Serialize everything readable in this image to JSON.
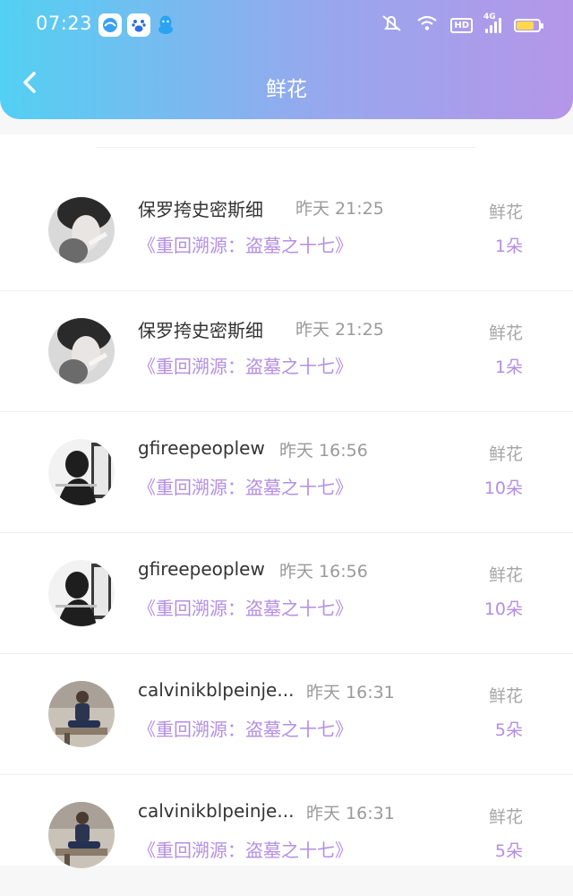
{
  "status_bar": {
    "time": "07:23",
    "network": "4G",
    "hd": "HD",
    "battery_level": 0.85,
    "icons": [
      "browser-app-icon",
      "baidu-app-icon",
      "qq-app-icon",
      "mute-icon",
      "wifi-icon",
      "hd-icon",
      "signal-icon",
      "battery-icon"
    ]
  },
  "nav": {
    "title": "鲜花",
    "back_icon": "chevron-left-icon"
  },
  "colors": {
    "header_gradient_start": "#53d0f3",
    "header_gradient_end": "#b596e8",
    "accent_purple": "#b48ee4",
    "muted_text": "#9a9a9a"
  },
  "records": [
    {
      "username": "保罗挎史密斯细",
      "time": "昨天 21:25",
      "book": "《重回溯源：盗墓之十七》",
      "gift_label": "鲜花",
      "gift_count": "1朵"
    },
    {
      "username": "保罗挎史密斯细",
      "time": "昨天 21:25",
      "book": "《重回溯源：盗墓之十七》",
      "gift_label": "鲜花",
      "gift_count": "1朵"
    },
    {
      "username": "gfireepeoplew",
      "time": "昨天 16:56",
      "book": "《重回溯源：盗墓之十七》",
      "gift_label": "鲜花",
      "gift_count": "10朵"
    },
    {
      "username": "gfireepeoplew",
      "time": "昨天 16:56",
      "book": "《重回溯源：盗墓之十七》",
      "gift_label": "鲜花",
      "gift_count": "10朵"
    },
    {
      "username": "calvinikblpeinje...",
      "time": "昨天 16:31",
      "book": "《重回溯源：盗墓之十七》",
      "gift_label": "鲜花",
      "gift_count": "5朵"
    },
    {
      "username": "calvinikblpeinje...",
      "time": "昨天 16:31",
      "book": "《重回溯源：盗墓之十七》",
      "gift_label": "鲜花",
      "gift_count": "5朵"
    }
  ]
}
